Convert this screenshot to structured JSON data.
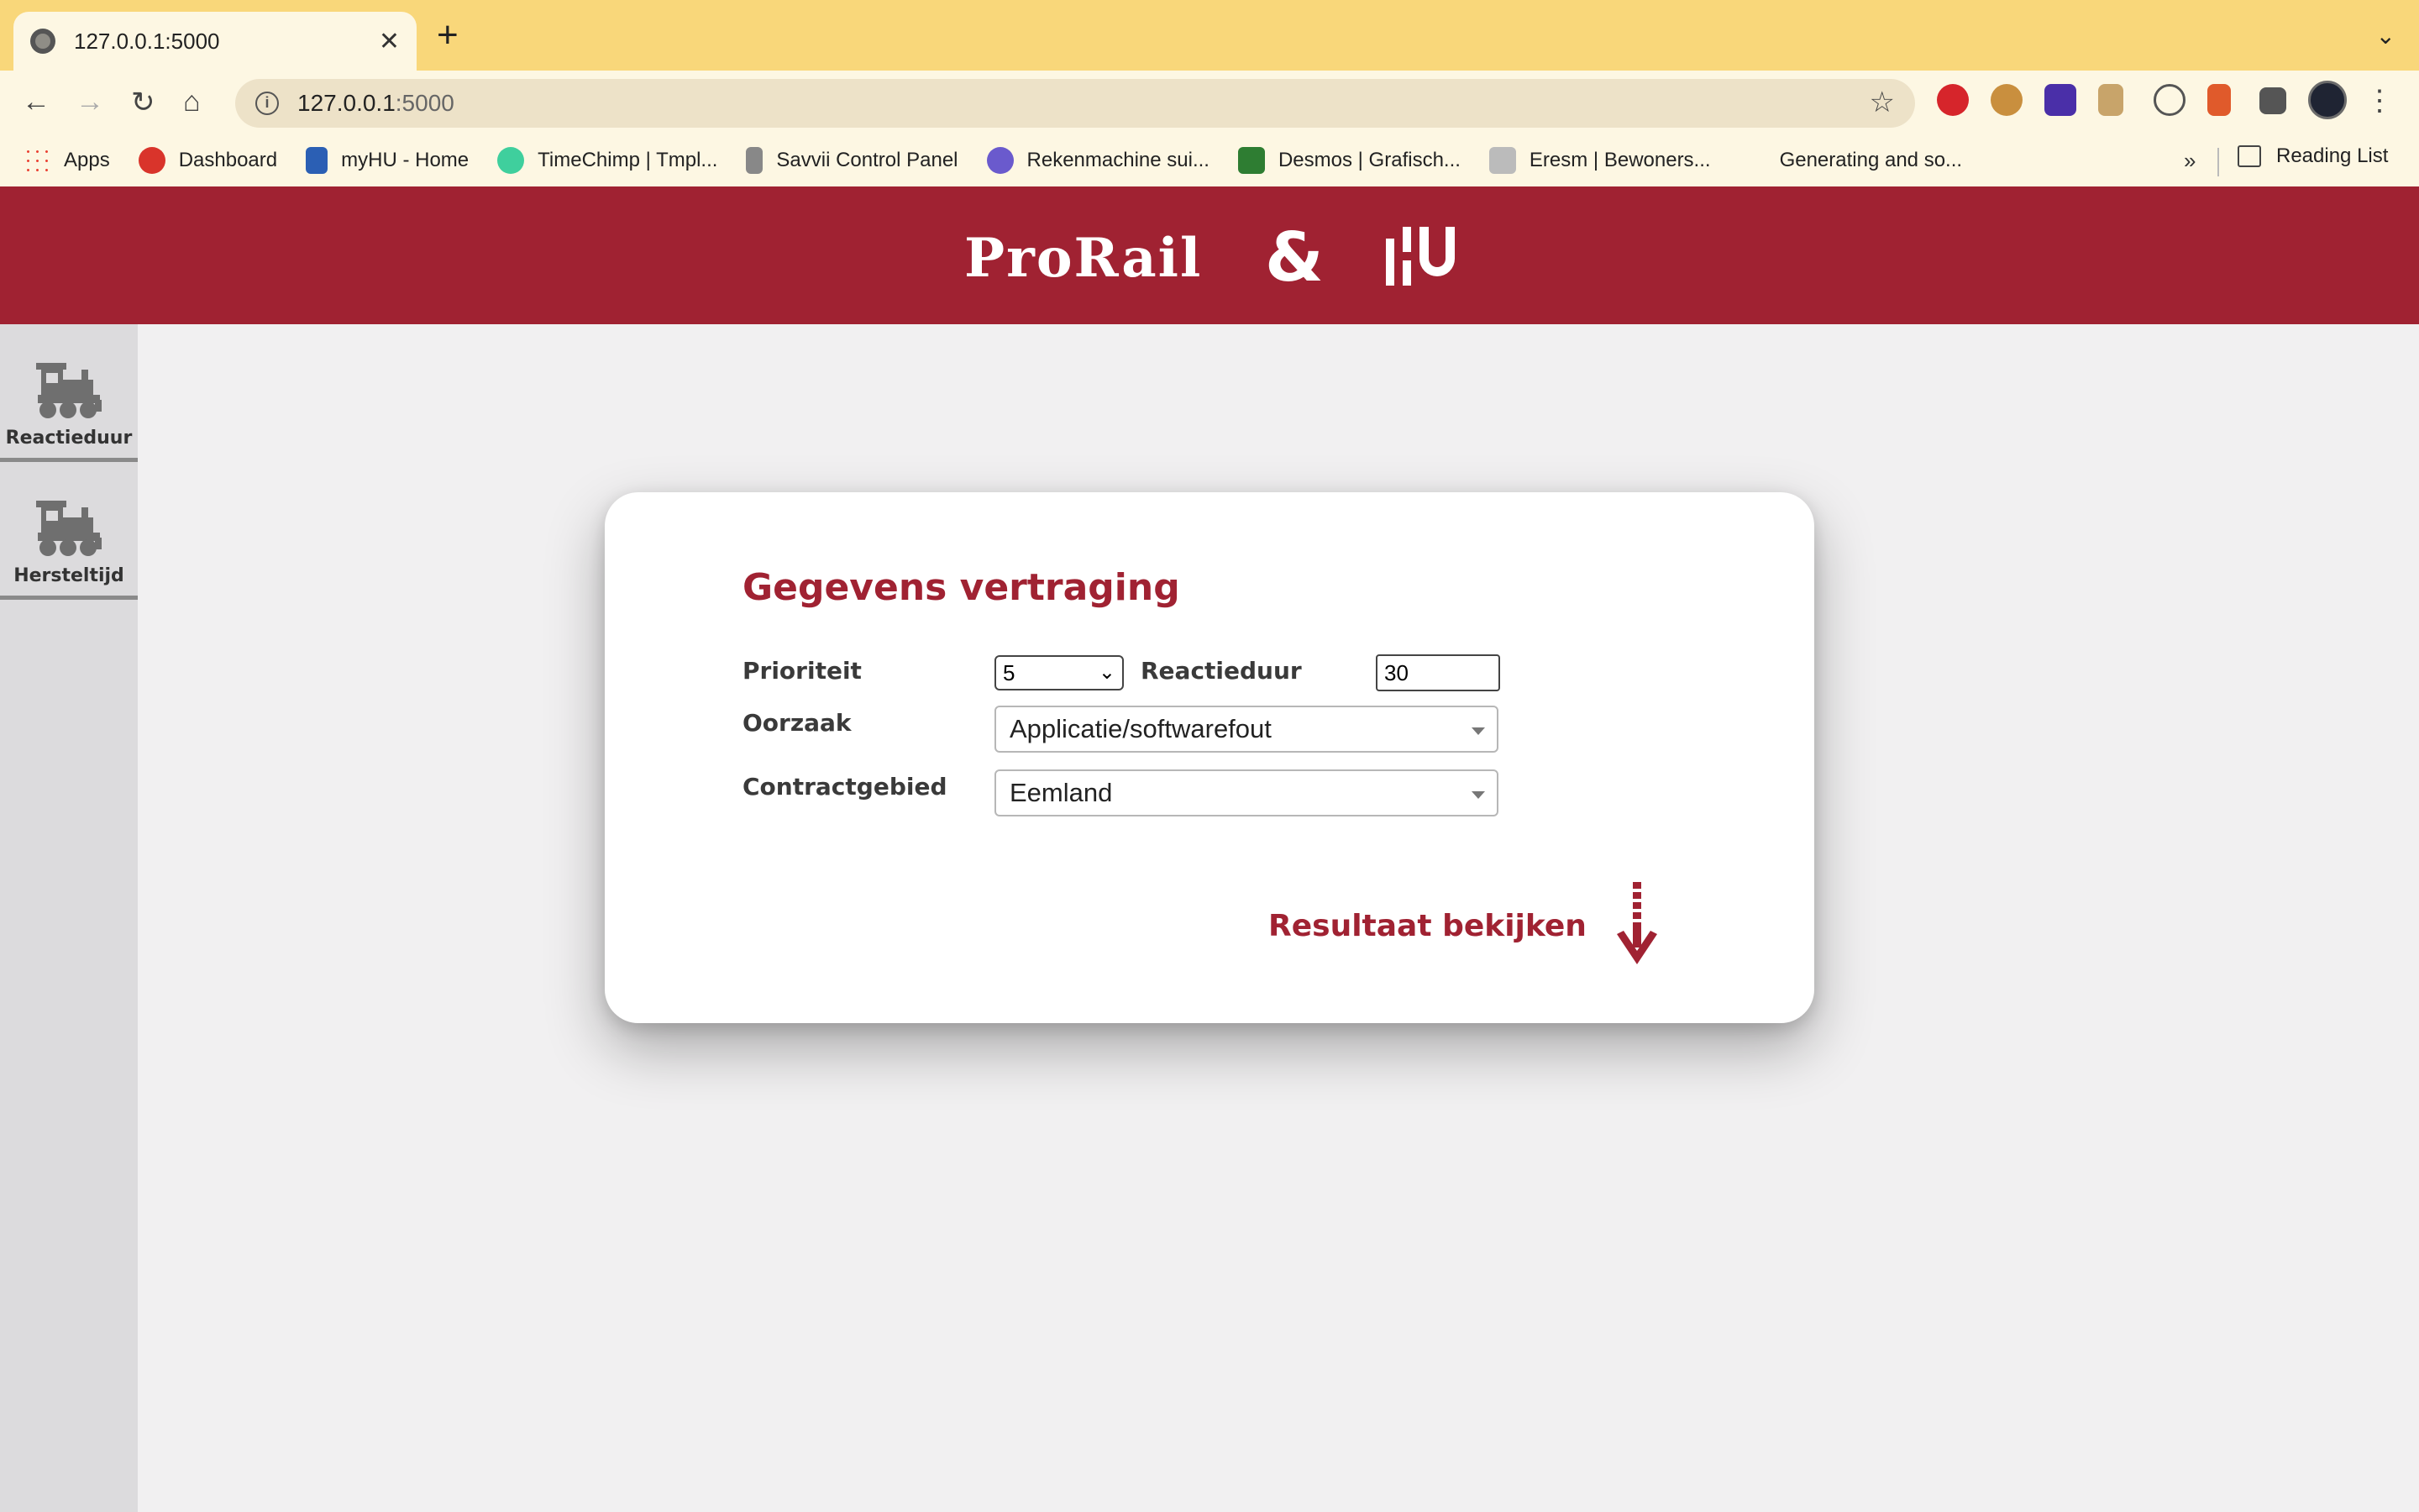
{
  "browser": {
    "tab_title": "127.0.0.1:5000",
    "url_host": "127.0.0.1",
    "url_port": ":5000",
    "bookmarks": [
      {
        "label": "Apps",
        "color": "#4285f4"
      },
      {
        "label": "Dashboard",
        "color": "#d9342b"
      },
      {
        "label": "myHU - Home",
        "color": "#2b5fb4"
      },
      {
        "label": "TimeChimp | Tmpl...",
        "color": "#3fcf9d"
      },
      {
        "label": "Savvii Control Panel",
        "color": "#666666"
      },
      {
        "label": "Rekenmachine sui...",
        "color": "#6a5acd"
      },
      {
        "label": "Desmos | Grafisch...",
        "color": "#2e7d32"
      },
      {
        "label": "Eresm | Bewoners...",
        "color": "#999999"
      },
      {
        "label": "Generating and so...",
        "color": "#fdf7e3"
      }
    ],
    "more_label": "»",
    "reading_list": "Reading List"
  },
  "header": {
    "logo_left": "ProRail",
    "logo_amp": "&",
    "logo_right": "HU"
  },
  "sidebar": {
    "items": [
      {
        "label": "Reactieduur",
        "icon": "train-icon"
      },
      {
        "label": "Hersteltijd",
        "icon": "train-icon"
      }
    ]
  },
  "form": {
    "title": "Gegevens vertraging",
    "prioriteit_label": "Prioriteit",
    "prioriteit_value": "5",
    "reactieduur_label": "Reactieduur",
    "reactieduur_value": "30",
    "oorzaak_label": "Oorzaak",
    "oorzaak_value": "Applicatie/softwarefout",
    "contractgebied_label": "Contractgebied",
    "contractgebied_value": "Eemland",
    "submit_label": "Resultaat bekijken"
  },
  "colors": {
    "brand": "#a02232",
    "tabstrip": "#f9d77a",
    "toolbar": "#fdf7e3",
    "page_bg": "#f1f0f1",
    "sidebar_bg": "#dcdbdd"
  }
}
